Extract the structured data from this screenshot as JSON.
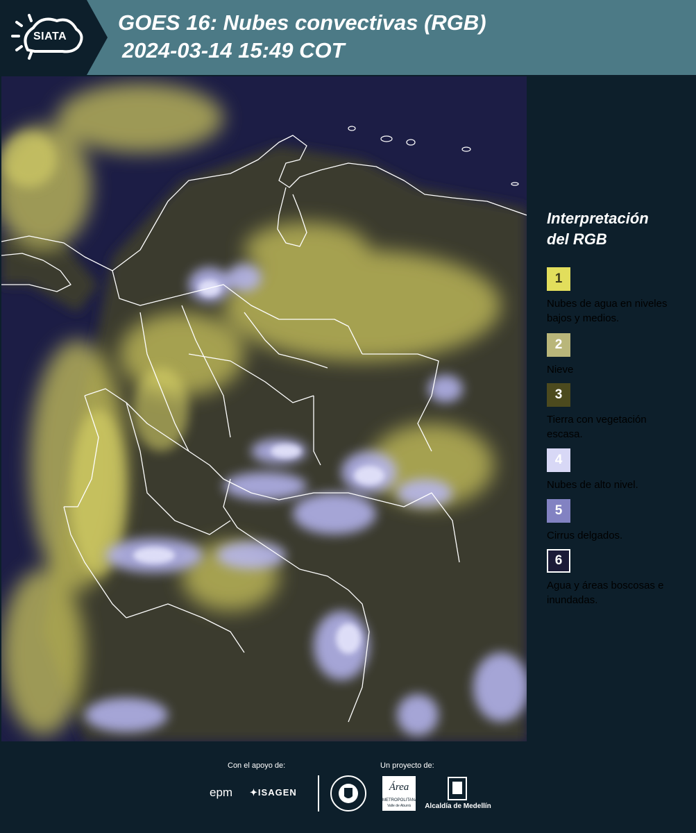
{
  "header": {
    "logo_text": "SIATA",
    "title": "GOES 16: Nubes convectivas (RGB)",
    "subtitle": "2024-03-14 15:49 COT"
  },
  "legend": {
    "title_line1": "Interpretación",
    "title_line2": "del RGB",
    "items": [
      {
        "number": "1",
        "label": "Nubes de agua en niveles bajos y medios.",
        "color": "#e2de5c",
        "text_color": "#3b3a1a"
      },
      {
        "number": "2",
        "label": "Nieve",
        "color": "#b9b67a",
        "text_color": "#ffffff"
      },
      {
        "number": "3",
        "label": "Tierra con vegetación escasa.",
        "color": "#4c4a1e",
        "text_color": "#ffffff"
      },
      {
        "number": "4",
        "label": "Nubes de alto nivel.",
        "color": "#d8d8f6",
        "text_color": "#ffffff"
      },
      {
        "number": "5",
        "label": "Cirrus delgados.",
        "color": "#8282c2",
        "text_color": "#ffffff"
      },
      {
        "number": "6",
        "label": "Agua y áreas boscosas e inundadas.",
        "color": "#1b1a37",
        "text_color": "#ffffff"
      }
    ]
  },
  "footer": {
    "support_label": "Con el apoyo de:",
    "project_label": "Un proyecto de:",
    "sponsor_epm": "epm",
    "sponsor_isagen": "ISAGEN",
    "area_name": "Área",
    "area_subtitle": "METROPOLITANA",
    "area_subtitle2": "Valle de Aburrá",
    "alcaldia": "Alcaldía de Medellín"
  },
  "colors": {
    "header_bg": "#4c7a86",
    "page_bg": "#0d1f2b",
    "map_bg": "#1c1d45",
    "low_cloud": "#d9d56a",
    "high_cloud": "#c9c9f5",
    "boundary": "#ffffff"
  }
}
